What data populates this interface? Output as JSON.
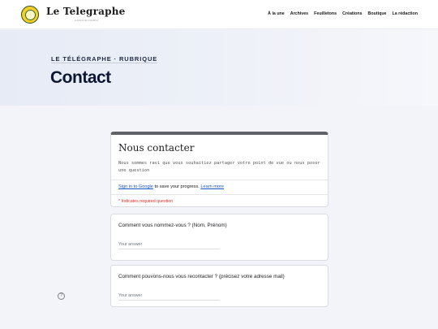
{
  "header": {
    "brand": "Le Telegraphe",
    "tagline": "journal de création",
    "nav": [
      "À la une",
      "Archives",
      "Feuilletons",
      "Créations",
      "Boutique",
      "La rédaction"
    ]
  },
  "hero": {
    "kicker": "LE TÉLÉGRAPHE · RUBRIQUE",
    "title": "Contact"
  },
  "form": {
    "title": "Nous contacter",
    "description": "Nous sommes ravi que vous souhaitiez partager votre point de vue ou nous poser une question",
    "signin_link": "Sign in to Google",
    "signin_rest": " to save your progress. ",
    "learn_more": "Learn more",
    "required_note": "* Indicates required question",
    "questions": [
      {
        "label": "Comment vous nommez-vous ? (Nom, Prénom)",
        "placeholder": "Your answer"
      },
      {
        "label": "Comment pouvons-nous vous recontacter ? (précisez votre adresse mail)",
        "placeholder": "Your answer"
      }
    ]
  },
  "help_icon": "?",
  "colors": {
    "accent": "#1a57c9",
    "required": "#d93025",
    "title": "#0e1633"
  }
}
